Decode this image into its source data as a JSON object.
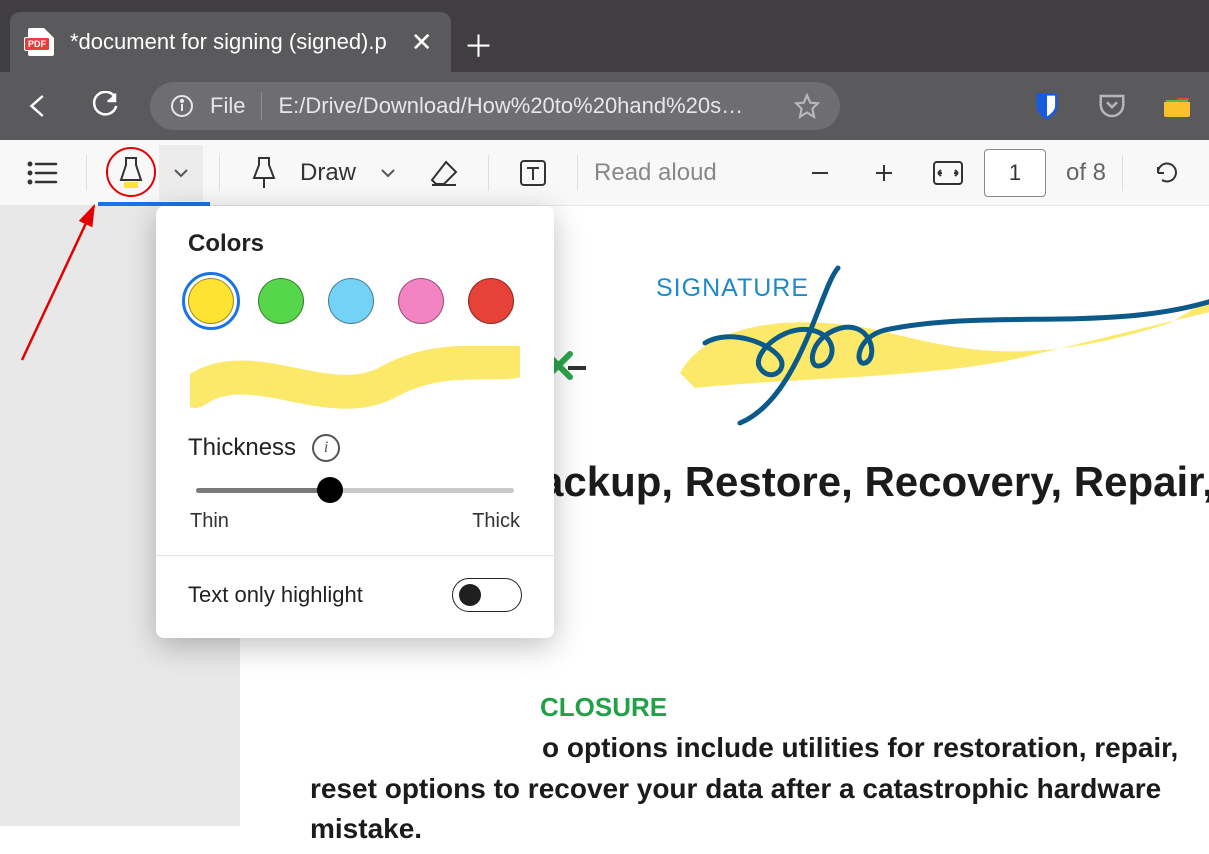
{
  "browser": {
    "tab_title": "*document for signing (signed).p",
    "url_scheme_label": "File",
    "url_path": "E:/Drive/Download/How%20to%20hand%20s…"
  },
  "toolbar": {
    "draw_label": "Draw",
    "read_aloud_label": "Read aloud",
    "page_current": "1",
    "page_total_label": "of 8"
  },
  "popup": {
    "colors_heading": "Colors",
    "thickness_heading": "Thickness",
    "thin_label": "Thin",
    "thick_label": "Thick",
    "toggle_label": "Text only highlight",
    "toggle_state": false,
    "selected_color_index": 0,
    "colors": [
      {
        "name": "yellow",
        "hex": "#ffe333"
      },
      {
        "name": "green",
        "hex": "#56d64a"
      },
      {
        "name": "lightblue",
        "hex": "#74d2f7"
      },
      {
        "name": "pink",
        "hex": "#f383c3"
      },
      {
        "name": "red",
        "hex": "#e64238"
      }
    ],
    "thickness_value": 42
  },
  "document": {
    "signature_label": "SIGNATURE",
    "heading_partial": "ackup, Restore, Recovery, Repair, R",
    "section_label_partial": "CLOSURE",
    "paragraph_line1_partial": "o options include utilities for restoration, repair,",
    "paragraph_line2": "reset options to recover your data after a catastrophic hardware",
    "paragraph_line3": "mistake."
  }
}
